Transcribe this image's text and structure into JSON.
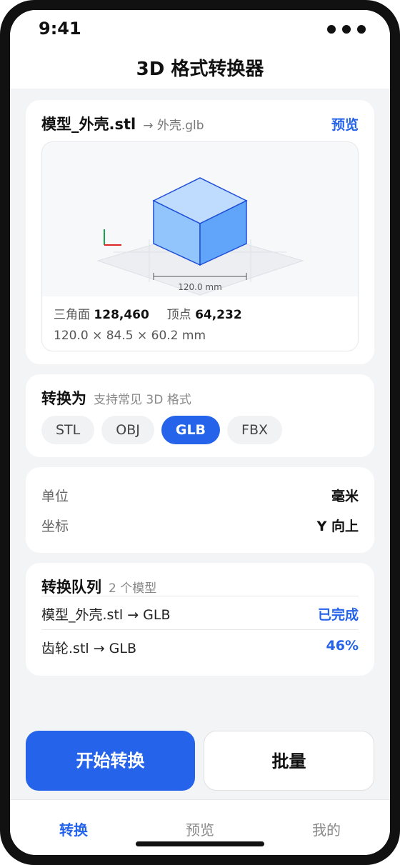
{
  "status": {
    "time": "9:41"
  },
  "app": {
    "title": "3D 格式转换器"
  },
  "model": {
    "filename": "模型_外壳.stl",
    "target": "→ 外壳.glb",
    "preview_link": "预览",
    "dimension_label": "120.0 mm",
    "triangles_label": "三角面",
    "triangles": "128,460",
    "vertices_label": "顶点",
    "vertices": "64,232",
    "size": "120.0 × 84.5 × 60.2 mm"
  },
  "convert": {
    "title": "转换为",
    "subtitle": "支持常见 3D 格式",
    "formats": [
      {
        "label": "STL",
        "selected": false
      },
      {
        "label": "OBJ",
        "selected": false
      },
      {
        "label": "GLB",
        "selected": true
      },
      {
        "label": "FBX",
        "selected": false
      }
    ]
  },
  "settings": {
    "unit_label": "单位",
    "unit_value": "毫米",
    "coord_label": "坐标",
    "coord_value": "Y 向上"
  },
  "queue": {
    "title": "转换队列",
    "count": "2 个模型",
    "items": [
      {
        "name": "模型_外壳.stl → GLB",
        "status": "已完成"
      },
      {
        "name": "齿轮.stl → GLB",
        "status": "46%"
      }
    ]
  },
  "actions": {
    "start": "开始转换",
    "batch": "批量"
  },
  "tabs": [
    {
      "label": "转换",
      "active": true
    },
    {
      "label": "预览",
      "active": false
    },
    {
      "label": "我的",
      "active": false
    }
  ],
  "colors": {
    "accent": "#2563eb",
    "cube_top": "#bfdbfe",
    "cube_left": "#93c5fd",
    "cube_right": "#60a5fa"
  }
}
